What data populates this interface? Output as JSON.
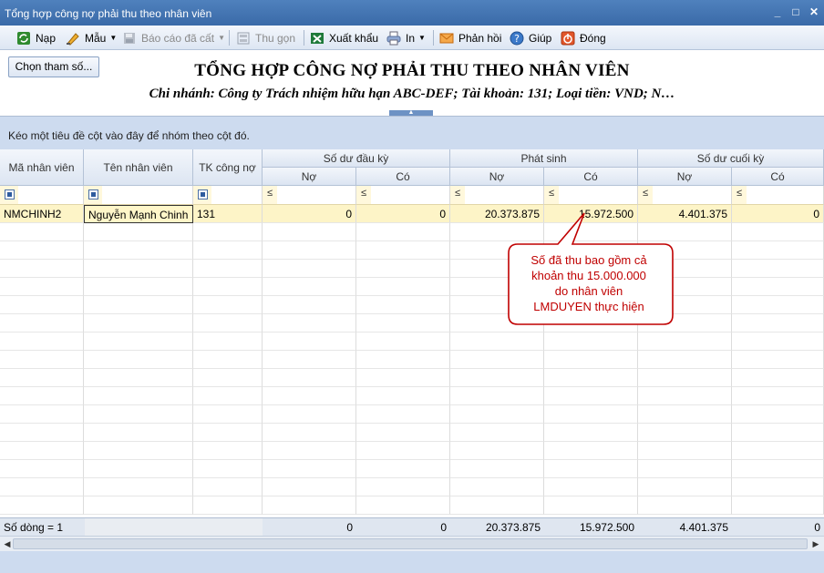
{
  "window": {
    "title": "Tổng hợp công nợ phải thu theo nhân viên",
    "controls": [
      "_",
      "□",
      "✕"
    ]
  },
  "toolbar": {
    "refresh": "Nạp",
    "template": "Mẫu",
    "saved_reports": "Báo cáo đã cất",
    "collapse": "Thu gọn",
    "export": "Xuất khẩu",
    "print": "In",
    "feedback": "Phản hồi",
    "help": "Giúp",
    "close": "Đóng"
  },
  "header": {
    "param_button": "Chọn tham số...",
    "title": "TỔNG HỢP CÔNG NỢ PHẢI THU THEO NHÂN VIÊN",
    "subtitle": "Chi nhánh: Công ty Trách nhiệm hữu hạn ABC-DEF; Tài khoản: 131; Loại tiền: VND; N…"
  },
  "grid": {
    "group_panel_text": "Kéo một tiêu đề cột vào đây để nhóm theo cột đó.",
    "columns": {
      "employee_code": "Mã nhân viên",
      "employee_name": "Tên nhân viên",
      "account": "TK công nợ",
      "opening": "Số dư đầu kỳ",
      "movement": "Phát sinh",
      "closing": "Số dư cuối kỳ",
      "debit": "Nợ",
      "credit": "Có"
    },
    "filter_operator": "≤",
    "rows": [
      {
        "employee_code": "NMCHINH2",
        "employee_name": "Nguyễn Mạnh Chinh",
        "account": "131",
        "opening_debit": "0",
        "opening_credit": "0",
        "movement_debit": "20.373.875",
        "movement_credit": "15.972.500",
        "closing_debit": "4.401.375",
        "closing_credit": "0"
      }
    ],
    "footer": {
      "row_count": "Số dòng = 1",
      "opening_debit": "0",
      "opening_credit": "0",
      "movement_debit": "20.373.875",
      "movement_credit": "15.972.500",
      "closing_debit": "4.401.375",
      "closing_credit": "0"
    }
  },
  "annotation": {
    "lines": [
      "Số đã thu bao gồm cả",
      "khoản thu 15.000.000",
      "do nhân viên",
      "LMDUYEN thực hiện"
    ],
    "color": "#c00000"
  }
}
